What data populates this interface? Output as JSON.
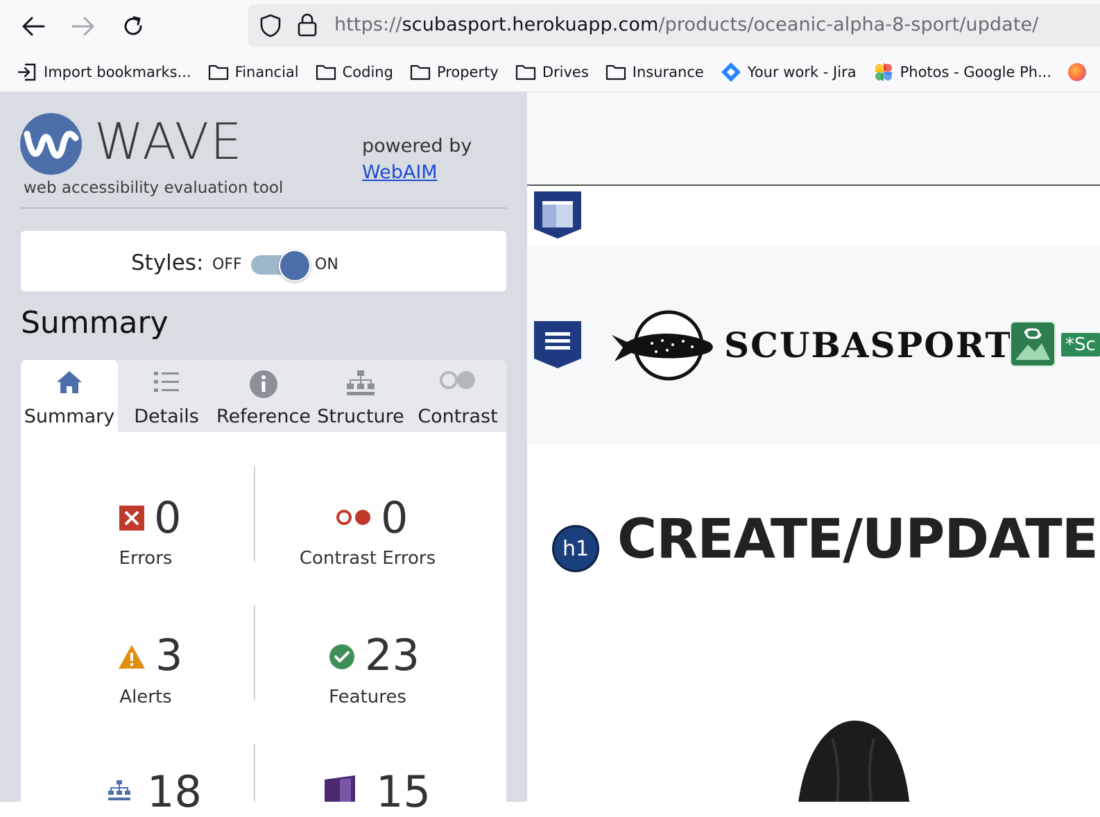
{
  "browser": {
    "url_prefix": "https://",
    "url_host": "scubasport.herokuapp.com",
    "url_path": "/products/oceanic-alpha-8-sport/update/",
    "bookmarks": [
      {
        "label": "Import bookmarks...",
        "icon": "import-icon"
      },
      {
        "label": "Financial",
        "icon": "folder-icon"
      },
      {
        "label": "Coding",
        "icon": "folder-icon"
      },
      {
        "label": "Property",
        "icon": "folder-icon"
      },
      {
        "label": "Drives",
        "icon": "folder-icon"
      },
      {
        "label": "Insurance",
        "icon": "folder-icon"
      },
      {
        "label": "Your work - Jira",
        "icon": "jira-icon"
      },
      {
        "label": "Photos - Google Ph...",
        "icon": "google-photos-icon"
      }
    ]
  },
  "wave": {
    "title": "WAVE",
    "subtitle": "web accessibility evaluation tool",
    "powered_by": "powered by",
    "powered_link": "WebAIM",
    "styles_label": "Styles:",
    "off_label": "OFF",
    "on_label": "ON",
    "styles_on": true,
    "summary_heading": "Summary",
    "tabs": [
      {
        "label": "Summary",
        "icon": "home-icon",
        "active": true
      },
      {
        "label": "Details",
        "icon": "list-icon",
        "active": false
      },
      {
        "label": "Reference",
        "icon": "info-icon",
        "active": false
      },
      {
        "label": "Structure",
        "icon": "structure-icon",
        "active": false
      },
      {
        "label": "Contrast",
        "icon": "contrast-icon",
        "active": false
      }
    ],
    "stats": {
      "errors": {
        "value": "0",
        "label": "Errors",
        "color": "#c0392b"
      },
      "contrast_errors": {
        "value": "0",
        "label": "Contrast Errors",
        "color": "#c0392b"
      },
      "alerts": {
        "value": "3",
        "label": "Alerts",
        "color": "#e08e0b"
      },
      "features": {
        "value": "23",
        "label": "Features",
        "color": "#3f8f5a"
      },
      "structure": {
        "value": "18"
      },
      "aria": {
        "value": "15"
      }
    }
  },
  "page": {
    "brand": "SCUBASPORT",
    "h1_badge": "h1",
    "heading": "CREATE/UPDATE PR",
    "link_tag": "*Sc"
  }
}
